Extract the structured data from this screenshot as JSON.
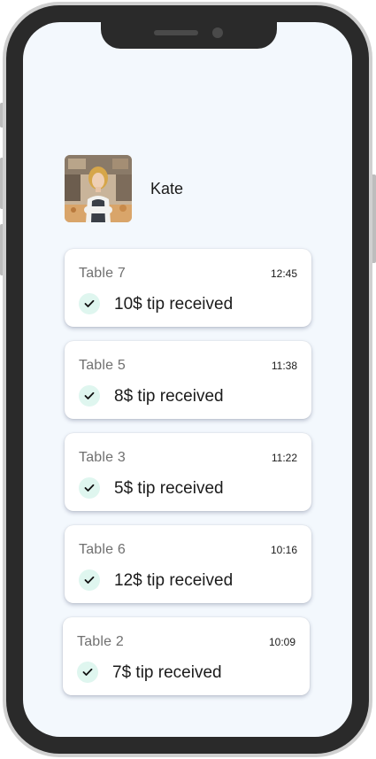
{
  "profile": {
    "name": "Kate",
    "avatar_icon": "waitress-photo"
  },
  "notifications": [
    {
      "table": "Table 7",
      "time": "12:45",
      "message": "10$ tip received"
    },
    {
      "table": "Table 5",
      "time": "11:38",
      "message": "8$ tip received"
    },
    {
      "table": "Table 3",
      "time": "11:22",
      "message": "5$ tip received"
    },
    {
      "table": "Table 6",
      "time": "10:16",
      "message": "12$ tip received"
    },
    {
      "table": "Table 2",
      "time": "10:09",
      "message": "7$ tip received"
    }
  ],
  "colors": {
    "screen_bg": "#f3f8fd",
    "check_bg": "#dff6ef",
    "frame": "#2a2a2a"
  }
}
